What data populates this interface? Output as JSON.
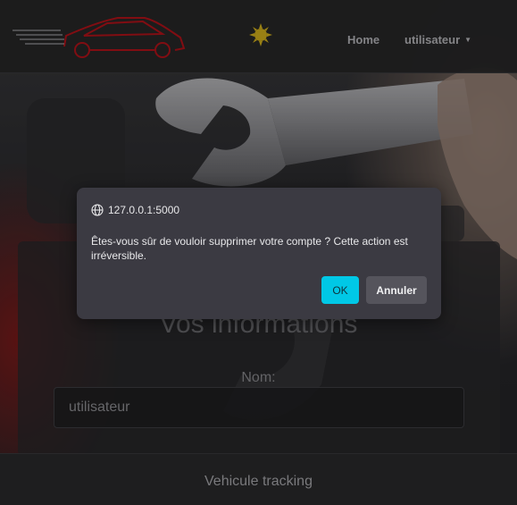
{
  "navbar": {
    "home_label": "Home",
    "user_label": "utilisateur"
  },
  "card": {
    "title": "Vos informations",
    "name_label": "Nom:",
    "name_value": "utilisateur"
  },
  "footer": {
    "text": "Vehicule tracking"
  },
  "dialog": {
    "origin": "127.0.0.1:5000",
    "message": "Êtes-vous sûr de vouloir supprimer votre compte ? Cette action est irréversible.",
    "ok_label": "OK",
    "cancel_label": "Annuler"
  },
  "icons": {
    "logo": "car-logo-icon",
    "theme": "sun-icon",
    "dropdown": "caret-down-icon",
    "origin": "globe-icon"
  },
  "colors": {
    "accent": "#00c8e6",
    "logo_red": "#b3121a",
    "dialog_bg": "#3b3a42"
  }
}
